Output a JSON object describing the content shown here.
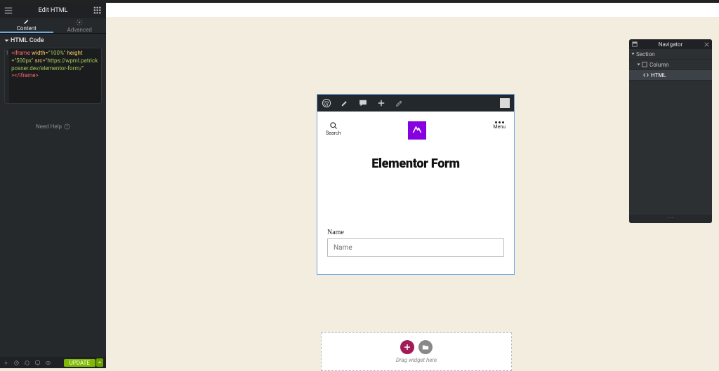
{
  "header": {
    "title": "Edit HTML"
  },
  "tabs": {
    "content": "Content",
    "advanced": "Advanced"
  },
  "section": {
    "html_code": "HTML Code"
  },
  "code_line": "1",
  "code": {
    "tag_open": "<iframe",
    "attr_width": "width=",
    "val_width": "\"100%\"",
    "attr_height": "height",
    "eq": "=",
    "val_height": "\"500px\"",
    "attr_src": "src=",
    "val_src": "\"https://wpml.patrickposner.dev/elementor-form/\"",
    "tag_close": "></iframe>"
  },
  "help": "Need Help",
  "footer": {
    "update": "UPDATE"
  },
  "preview": {
    "search": "Search",
    "menu": "Menu",
    "heading": "Elementor Form",
    "name_label": "Name",
    "name_placeholder": "Name"
  },
  "dropzone": {
    "text": "Drag widget here"
  },
  "navigator": {
    "title": "Navigator",
    "section": "Section",
    "column": "Column",
    "html": "HTML"
  }
}
